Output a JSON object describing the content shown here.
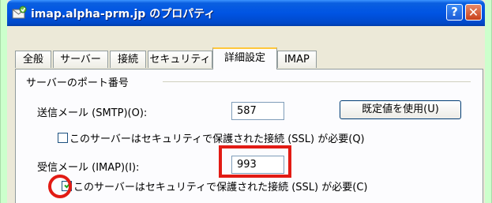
{
  "window": {
    "title": "imap.alpha-prm.jp のプロパティ",
    "help_label": "?",
    "close_label": "✕"
  },
  "tabs": [
    {
      "label": "全般",
      "active": false
    },
    {
      "label": "サーバー",
      "active": false
    },
    {
      "label": "接続",
      "active": false
    },
    {
      "label": "セキュリティ",
      "active": false
    },
    {
      "label": "詳細設定",
      "active": true
    },
    {
      "label": "IMAP",
      "active": false
    }
  ],
  "server_ports": {
    "group_label": "サーバーのポート番号",
    "smtp_label": "送信メール (SMTP)(O):",
    "smtp_value": "587",
    "defaults_button_label": "既定値を使用(U)",
    "smtp_ssl_label": "このサーバーはセキュリティで保護された接続 (SSL) が必要(Q)",
    "smtp_ssl_checked": false,
    "imap_label": "受信メール (IMAP)(I):",
    "imap_value": "993",
    "imap_ssl_label": "このサーバーはセキュリティで保護された接続 (SSL) が必要(C)",
    "imap_ssl_checked": true
  },
  "colors": {
    "background": "#ccffcc",
    "highlight": "#e21b14",
    "titlebar": "#0054e3"
  }
}
